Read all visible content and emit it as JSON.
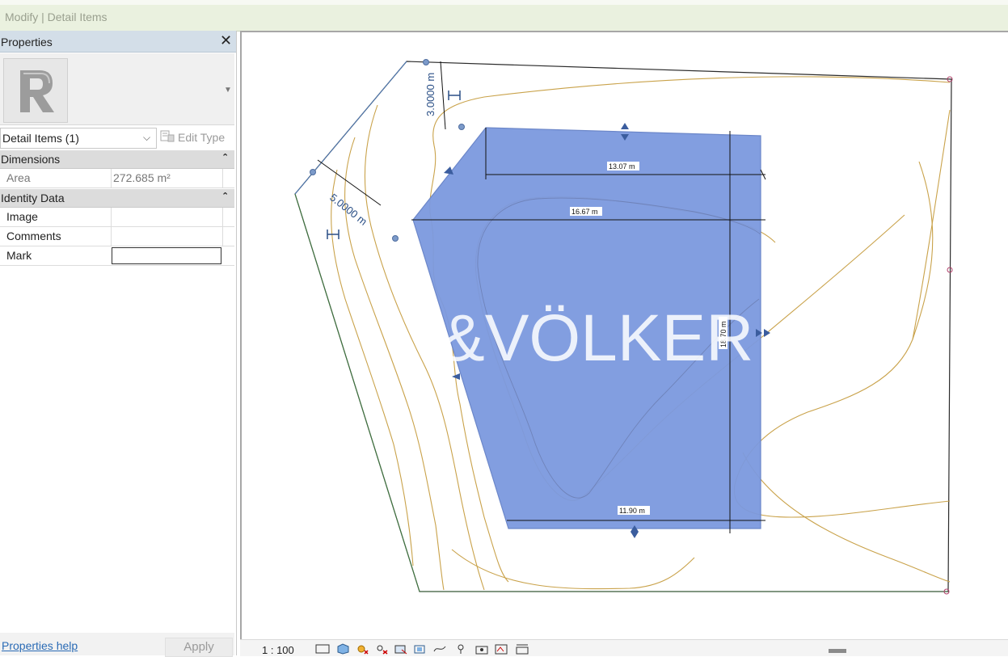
{
  "window": {
    "title": "Modify | Detail Items"
  },
  "properties": {
    "header": "Properties",
    "close_icon": "close-icon",
    "type_selector": {
      "value": "Detail Items (1)"
    },
    "edit_type_label": "Edit Type",
    "groups": [
      {
        "label": "Dimensions",
        "rows": [
          {
            "name": "Area",
            "value": "272.685 m²"
          }
        ]
      },
      {
        "label": "Identity Data",
        "rows": [
          {
            "name": "Image",
            "value": ""
          },
          {
            "name": "Comments",
            "value": ""
          },
          {
            "name": "Mark",
            "value": ""
          }
        ]
      }
    ],
    "help_link": "Properties help",
    "apply_label": "Apply"
  },
  "drawing": {
    "dimensions": {
      "d1": "3.0000 m",
      "d2": "5.0000 m",
      "d3": "13.07 m",
      "d4": "16.67 m",
      "d5": "18.70 m",
      "d6": "11.90 m"
    },
    "watermark": "&VÖLKER",
    "colors": {
      "region_fill": "#7b99de",
      "region_stroke": "#6c87c9",
      "contour": "#c9a24a",
      "boundary": "#2b2b2b"
    }
  },
  "statusbar": {
    "scale": "1 : 100"
  }
}
